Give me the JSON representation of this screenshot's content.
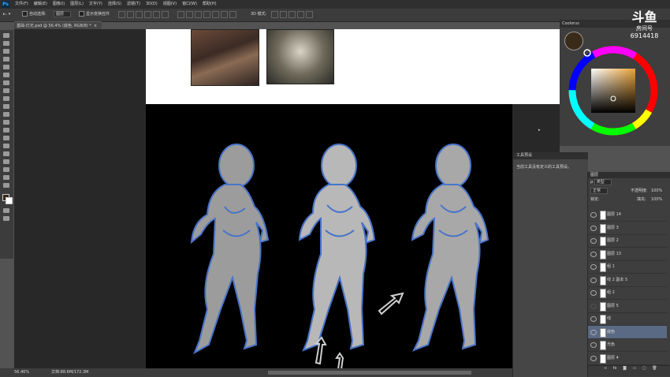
{
  "menubar": {
    "logo": "Ps",
    "items": [
      "文件(F)",
      "编辑(E)",
      "图像(I)",
      "图层(L)",
      "文字(Y)",
      "选择(S)",
      "滤镜(T)",
      "3D(D)",
      "视图(V)",
      "窗口(W)",
      "帮助(H)"
    ]
  },
  "options": {
    "auto_select_label": "自动选择:",
    "auto_select_value": "图层",
    "show_transform_label": "显示变换控件",
    "mode_3d_label": "3D 模式:"
  },
  "document": {
    "tab_title": "基础-灯光.psd @ 56.4% (底色, RGB/8) *",
    "zoom": "56.46%",
    "doc_info": "文档:88.6M/172.3M"
  },
  "color_panel": {
    "title": "Coolorus",
    "fg_color": "#3a2a18",
    "hue_color": "#e9a236"
  },
  "watermark": {
    "brand": "斗鱼",
    "sub": "房间号",
    "room": "6914418"
  },
  "tooltip_panel": {
    "title": "工具预设",
    "message": "当前工具没有定义的工具预设。"
  },
  "layers_panel": {
    "title": "图层",
    "kind_label": "类型",
    "blend_mode": "正常",
    "opacity_label": "不透明度:",
    "opacity_value": "100%",
    "lock_label": "锁定:",
    "fill_label": "填充:",
    "fill_value": "100%",
    "layers": [
      {
        "name": "图层 14",
        "visible": true,
        "selected": false
      },
      {
        "name": "图层 3",
        "visible": true,
        "selected": false
      },
      {
        "name": "图层 2",
        "visible": true,
        "selected": false
      },
      {
        "name": "图层 13",
        "visible": true,
        "selected": false
      },
      {
        "name": "组 1",
        "visible": true,
        "selected": false
      },
      {
        "name": "线 2 副本 5",
        "visible": true,
        "selected": false
      },
      {
        "name": "组 2",
        "visible": true,
        "selected": false
      },
      {
        "name": "图层 5",
        "visible": false,
        "selected": false
      },
      {
        "name": "线",
        "visible": true,
        "selected": false
      },
      {
        "name": "底色",
        "visible": true,
        "selected": true
      },
      {
        "name": "光色",
        "visible": true,
        "selected": false
      },
      {
        "name": "图层 4",
        "visible": true,
        "selected": false
      }
    ]
  }
}
